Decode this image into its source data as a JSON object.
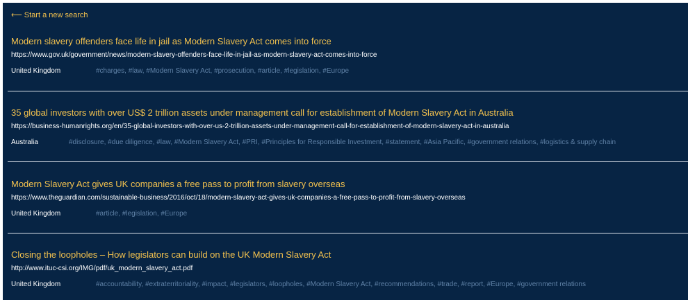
{
  "back_link": {
    "arrow": "⟵",
    "label": "Start a new search"
  },
  "results": [
    {
      "title": "Modern slavery offenders face life in jail as Modern Slavery Act comes into force",
      "url": "https://www.gov.uk/government/news/modern-slavery-offenders-face-life-in-jail-as-modern-slavery-act-comes-into-force",
      "country": "United Kingdom",
      "tags": "#charges, #law, #Modern Slavery Act, #prosecution, #article, #legislation, #Europe"
    },
    {
      "title": "35 global investors with over US$ 2 trillion assets under management call for establishment of Modern Slavery Act in Australia",
      "url": "https://business-humanrights.org/en/35-global-investors-with-over-us-2-trillion-assets-under-management-call-for-establishment-of-modern-slavery-act-in-australia",
      "country": "Australia",
      "tags": "#disclosure, #due diligence, #law, #Modern Slavery Act, #PRI, #Principles for Responsible Investment, #statement, #Asia Pacific, #government relations, #logistics & supply chain"
    },
    {
      "title": "Modern Slavery Act gives UK companies a free pass to profit from slavery overseas",
      "url": "https://www.theguardian.com/sustainable-business/2016/oct/18/modern-slavery-act-gives-uk-companies-a-free-pass-to-profit-from-slavery-overseas",
      "country": "United Kingdom",
      "tags": "#article, #legislation, #Europe"
    },
    {
      "title": "Closing the loopholes – How legislators can build on the UK Modern Slavery Act",
      "url": "http://www.ituc-csi.org/IMG/pdf/uk_modern_slavery_act.pdf",
      "country": "United Kingdom",
      "tags": "#accountability, #extraterritoriality, #impact, #legislators, #loopholes, #Modern Slavery Act, #recommendations, #trade, #report, #Europe, #government relations"
    }
  ],
  "colors": {
    "background": "#072444",
    "title": "#f2c14e",
    "url": "#ffffff",
    "country": "#ffffff",
    "tags": "#5f81a6",
    "divider": "#dfe5ec"
  }
}
